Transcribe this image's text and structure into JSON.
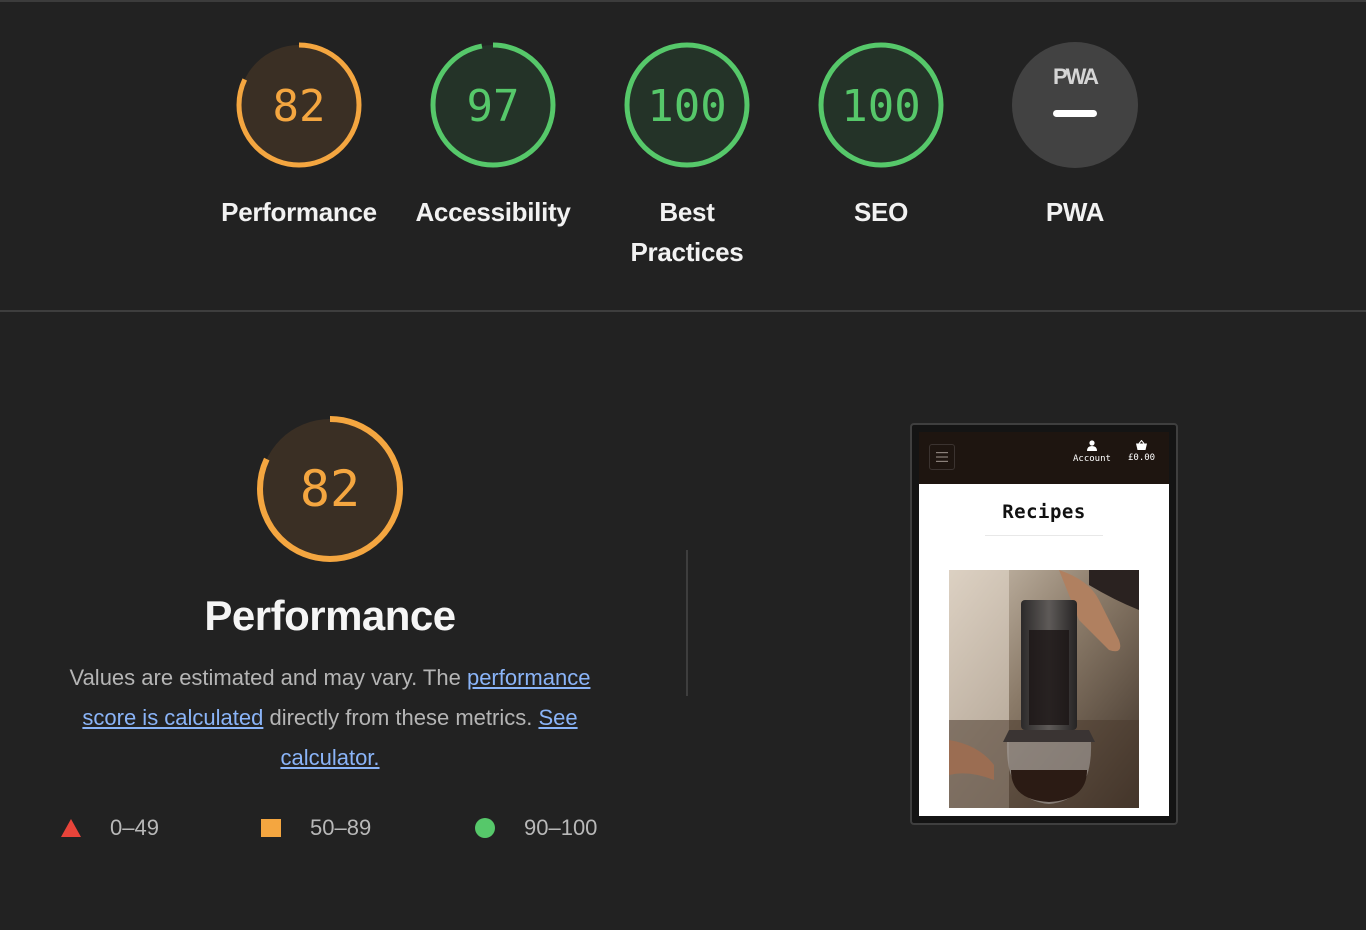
{
  "categories": [
    {
      "score": "82",
      "label": "Performance",
      "color": "#f4a640",
      "fill": "#3a2f24",
      "fraction": 0.82
    },
    {
      "score": "97",
      "label": "Accessibility",
      "color": "#56c86a",
      "fill": "#243328",
      "fraction": 0.97
    },
    {
      "score": "100",
      "label": "Best Practices",
      "color": "#56c86a",
      "fill": "#243328",
      "fraction": 1.0
    },
    {
      "score": "100",
      "label": "SEO",
      "color": "#56c86a",
      "fill": "#243328",
      "fraction": 1.0
    },
    {
      "score": "",
      "label": "PWA",
      "badge": "PWA",
      "icon": "pwa-badge-icon"
    }
  ],
  "performance": {
    "score": "82",
    "fraction": 0.82,
    "title": "Performance",
    "description_text": "Values are estimated and may vary. The ",
    "link_score": "performance score is calculated",
    "description_mid": " directly from these metrics. ",
    "link_calculator": "See calculator."
  },
  "legend": [
    {
      "range": "0–49",
      "shape": "triangle",
      "color": "#e8443a"
    },
    {
      "range": "50–89",
      "shape": "square",
      "color": "#f4a640"
    },
    {
      "range": "90–100",
      "shape": "circle",
      "color": "#56c86a"
    }
  ],
  "screenshot": {
    "nav_account": "Account",
    "nav_cart": "£0.00",
    "heading": "Recipes",
    "photo_alt_icon": "coffee-press-photo"
  }
}
